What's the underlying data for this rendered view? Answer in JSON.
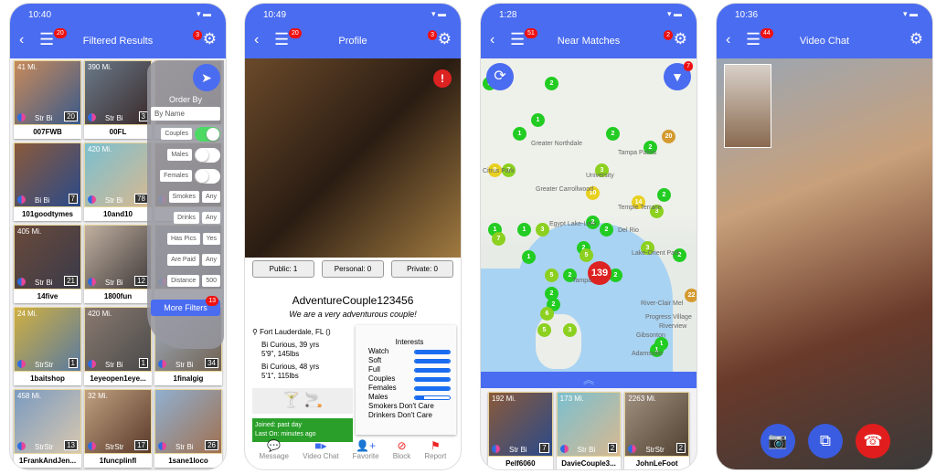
{
  "phone1": {
    "time": "10:40",
    "title": "Filtered Results",
    "menu_badge": "20",
    "gear_badge": "3",
    "tiles": [
      {
        "dist": "41 Mi.",
        "orient": "Str Bi",
        "count": "20",
        "name": "007FWB"
      },
      {
        "dist": "390 Mi.",
        "orient": "Str Bi",
        "count": "3",
        "name": "00FL"
      },
      {
        "dist": "",
        "orient": "",
        "count": "",
        "name": ""
      },
      {
        "dist": "",
        "orient": "Bi Bi",
        "count": "7",
        "name": "101goodtymes"
      },
      {
        "dist": "420 Mi.",
        "orient": "Str Bi",
        "count": "78",
        "name": "10and10"
      },
      {
        "dist": "",
        "orient": "",
        "count": "",
        "name": ""
      },
      {
        "dist": "405 Mi.",
        "orient": "Str Bi",
        "count": "21",
        "name": "14five"
      },
      {
        "dist": "",
        "orient": "Str Bi",
        "count": "12",
        "name": "1800fun"
      },
      {
        "dist": "",
        "orient": "",
        "count": "",
        "name": ""
      },
      {
        "dist": "24 Mi.",
        "orient": "StrStr",
        "count": "1",
        "name": "1baitshop"
      },
      {
        "dist": "420 Mi.",
        "orient": "Str Bi",
        "count": "1",
        "name": "1eyeopen1eye..."
      },
      {
        "dist": "",
        "orient": "Str Bi",
        "count": "34",
        "name": "1finalgig"
      },
      {
        "dist": "458 Mi.",
        "orient": "StrStr",
        "count": "13",
        "name": "1FrankAndJen..."
      },
      {
        "dist": "32 Mi.",
        "orient": "StrStr",
        "count": "17",
        "name": "1funcplinfl"
      },
      {
        "dist": "",
        "orient": "Str Bi",
        "count": "26",
        "name": "1sane1loco"
      }
    ],
    "filter": {
      "order_by": "Order By",
      "order_value": "By Name",
      "couples": "Couples",
      "males": "Males",
      "females": "Females",
      "smokes": "Smokes",
      "smokes_val": "Any",
      "drinks": "Drinks",
      "drinks_val": "Any",
      "has_pics": "Has Pics",
      "has_pics_val": "Yes",
      "are_paid": "Are Paid",
      "are_paid_val": "Any",
      "distance": "Distance",
      "distance_val": "500",
      "more": "More Filters",
      "more_badge": "13",
      "couples_on": true,
      "males_on": false,
      "females_on": false
    }
  },
  "phone2": {
    "time": "10:49",
    "title": "Profile",
    "menu_badge": "20",
    "gear_badge": "3",
    "public": "Public: 1",
    "personal": "Personal: 0",
    "private": "Private: 0",
    "username": "AdventureCouple123456",
    "tagline": "We are a very adventurous couple!",
    "location": "Fort Lauderdale, FL ()",
    "person1": [
      "Bi Curious, 39 yrs",
      "5'9\", 145lbs"
    ],
    "person2": [
      "Bi Curious, 48 yrs",
      "5'1\", 115lbs"
    ],
    "joined": "Joined: past day",
    "last_on": "Last On: minutes ago",
    "interests_title": "Interests",
    "interests": [
      {
        "label": "Watch",
        "level": 1
      },
      {
        "label": "Soft",
        "level": 1
      },
      {
        "label": "Full",
        "level": 1
      },
      {
        "label": "Couples",
        "level": 1
      },
      {
        "label": "Females",
        "level": 1
      },
      {
        "label": "Males",
        "level": 0.25
      }
    ],
    "smokers": "Smokers",
    "smokers_val": "Don't Care",
    "drinkers": "Drinkers",
    "drinkers_val": "Don't Care",
    "tabs": [
      "Message",
      "Video Chat",
      "Favorite",
      "Block",
      "Report"
    ]
  },
  "phone3": {
    "time": "1:28",
    "title": "Near Matches",
    "menu_badge": "51",
    "gear_badge": "2",
    "filter_badge": "7",
    "markers": [
      "2",
      "2",
      "1",
      "1",
      "2",
      "9",
      "7",
      "3",
      "2",
      "10",
      "2",
      "14",
      "3",
      "20",
      "2",
      "1",
      "3",
      "1",
      "2",
      "7",
      "2",
      "1",
      "3",
      "2",
      "5",
      "5",
      "2",
      "2",
      "139",
      "2",
      "2",
      "6",
      "5",
      "3",
      "1",
      "22",
      "1"
    ],
    "map_labels": [
      "Greater Northdale",
      "Citrus Park",
      "Greater Carrollwood",
      "University",
      "Tampa Palms",
      "Temple Terrace",
      "Egypt Lake-Leto",
      "Del Rio",
      "Lake-Orient Park",
      "Tampa",
      "River-Clair Mel",
      "Progress Village",
      "Gibsonton",
      "Adamsville",
      "Riverview"
    ],
    "tiles": [
      {
        "dist": "192 Mi.",
        "orient": "Str Bi",
        "count": "7",
        "name": "Pelf6060"
      },
      {
        "dist": "173 Mi.",
        "orient": "Str Bi",
        "count": "2",
        "name": "DavieCouple3..."
      },
      {
        "dist": "2263 Mi.",
        "orient": "StrStr",
        "count": "2",
        "name": "JohnLeFoot"
      }
    ]
  },
  "phone4": {
    "time": "10:36",
    "title": "Video Chat",
    "menu_badge": "44"
  }
}
